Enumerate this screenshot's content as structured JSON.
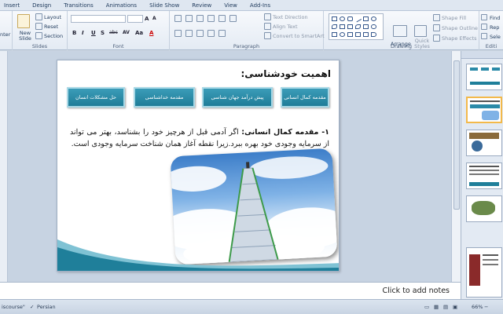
{
  "ribbon_tabs": [
    "Insert",
    "Design",
    "Transitions",
    "Animations",
    "Slide Show",
    "Review",
    "View",
    "Add-Ins"
  ],
  "ribbon": {
    "clipboard_partial": "nter",
    "new_slide": "New Slide",
    "layout": "Layout",
    "reset": "Reset",
    "section": "Section",
    "slides_group": "Slides",
    "font_group": "Font",
    "paragraph_group": "Paragraph",
    "drawing_group": "Drawing",
    "editing_group": "Editi",
    "text_direction": "Text Direction",
    "align_text": "Align Text",
    "convert_smartart": "Convert to SmartArt",
    "arrange": "Arrange",
    "quick_styles": "Quick Styles",
    "shape_fill": "Shape Fill",
    "shape_outline": "Shape Outline",
    "shape_effects": "Shape Effects",
    "find": "Find",
    "replace": "Rep",
    "select": "Sele",
    "font_buttons": [
      "B",
      "I",
      "U",
      "S",
      "abc",
      "AV",
      "Aa",
      "A"
    ]
  },
  "slide": {
    "title": "اهمیت خودشناسی:",
    "topics": [
      "مقدمه کمال انسانی",
      "پیش درآمد جهان شناسی",
      "مقدمه خداشناسی",
      "حل مشکلات انسان"
    ],
    "body_lead": "۱- مقدمه کمال انسانی:",
    "body_text": " اگر آدمی قبل از هرچیز خود را بشناسد، بهتر می تواند از سرمایه وجودی خود بهره ببرد.زیرا نقطه آغاز همان شناخت سرمایه وجودی است."
  },
  "notes_placeholder": "Click to add notes",
  "status": {
    "theme": "iscourse\"",
    "language": "Persian",
    "zoom": "66%"
  },
  "colors": {
    "topic_box": "#2a8aa8",
    "accent_wave": "#1f7f9a",
    "selected_thumb_border": "#f3b94a"
  }
}
